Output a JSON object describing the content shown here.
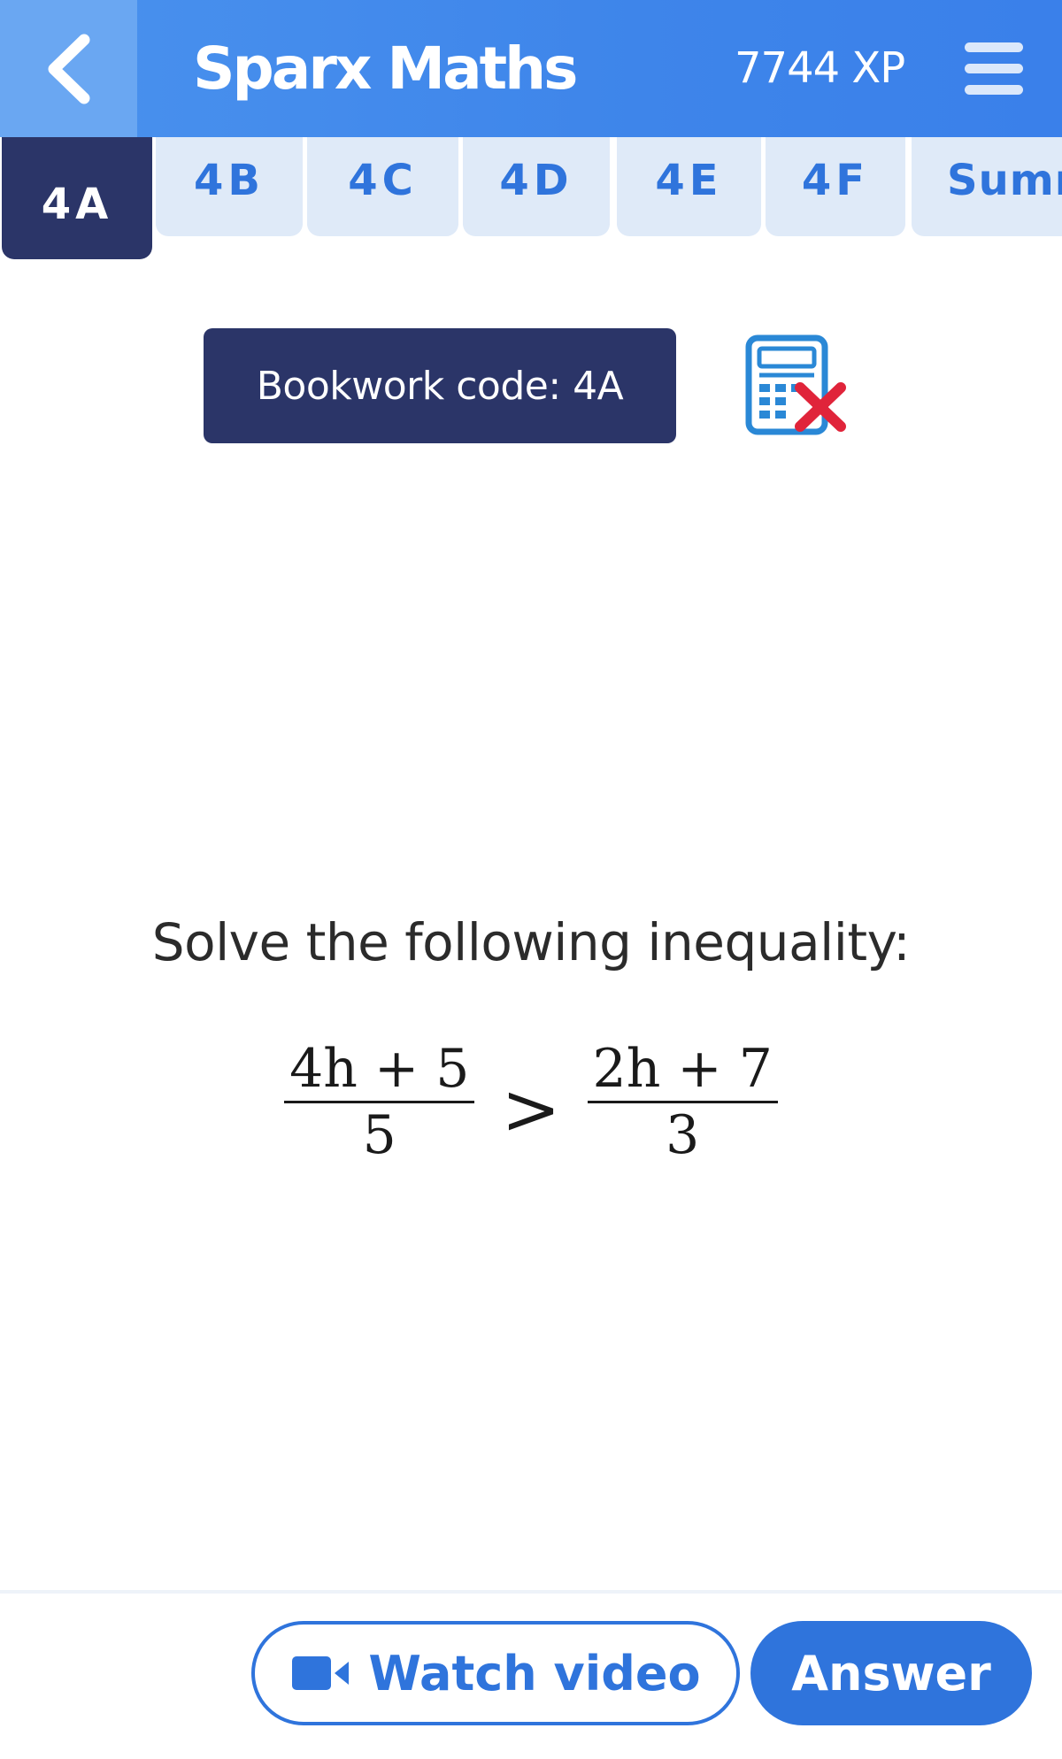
{
  "header": {
    "title": "Sparx Maths",
    "xp": "7744 XP",
    "back_icon": "chevron-left-icon",
    "menu_icon": "hamburger-menu-icon"
  },
  "tabs": [
    {
      "label": "4A",
      "active": true
    },
    {
      "label": "4B",
      "active": false
    },
    {
      "label": "4C",
      "active": false
    },
    {
      "label": "4D",
      "active": false
    },
    {
      "label": "4E",
      "active": false
    },
    {
      "label": "4F",
      "active": false
    },
    {
      "label": "Summ",
      "active": false
    }
  ],
  "bookwork": {
    "label": "Bookwork code: 4A",
    "calculator_icon": "calculator-not-allowed-icon"
  },
  "question": {
    "prompt": "Solve the following inequality:",
    "left_numerator": "4h + 5",
    "left_denominator": "5",
    "operator": ">",
    "right_numerator": "2h + 7",
    "right_denominator": "3"
  },
  "footer": {
    "watch_video_label": "Watch video",
    "answer_label": "Answer",
    "video_icon": "video-camera-icon"
  },
  "colors": {
    "header_blue": "#3e85ea",
    "navy": "#2b3568",
    "accent_blue": "#2f74dc",
    "tab_bg": "#dfeaf8",
    "error_red": "#e0243a"
  }
}
